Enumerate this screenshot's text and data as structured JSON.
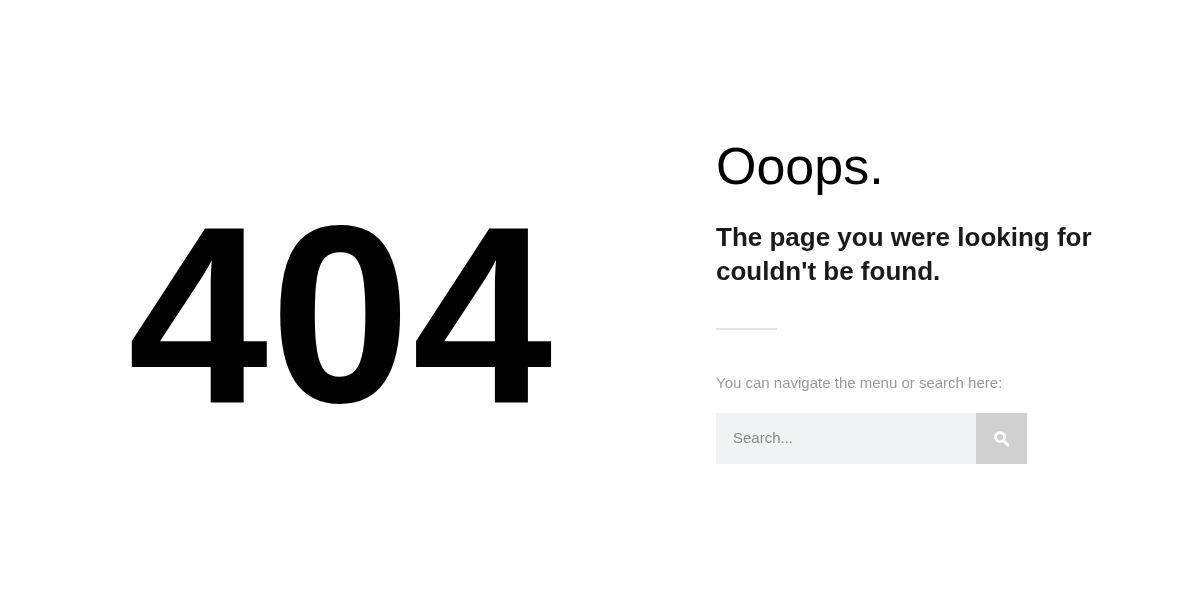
{
  "error_code": "404",
  "title": "Ooops.",
  "message": "The page you were looking for couldn't be found.",
  "hint": "You can navigate the menu or search here:",
  "search": {
    "placeholder": "Search..."
  }
}
